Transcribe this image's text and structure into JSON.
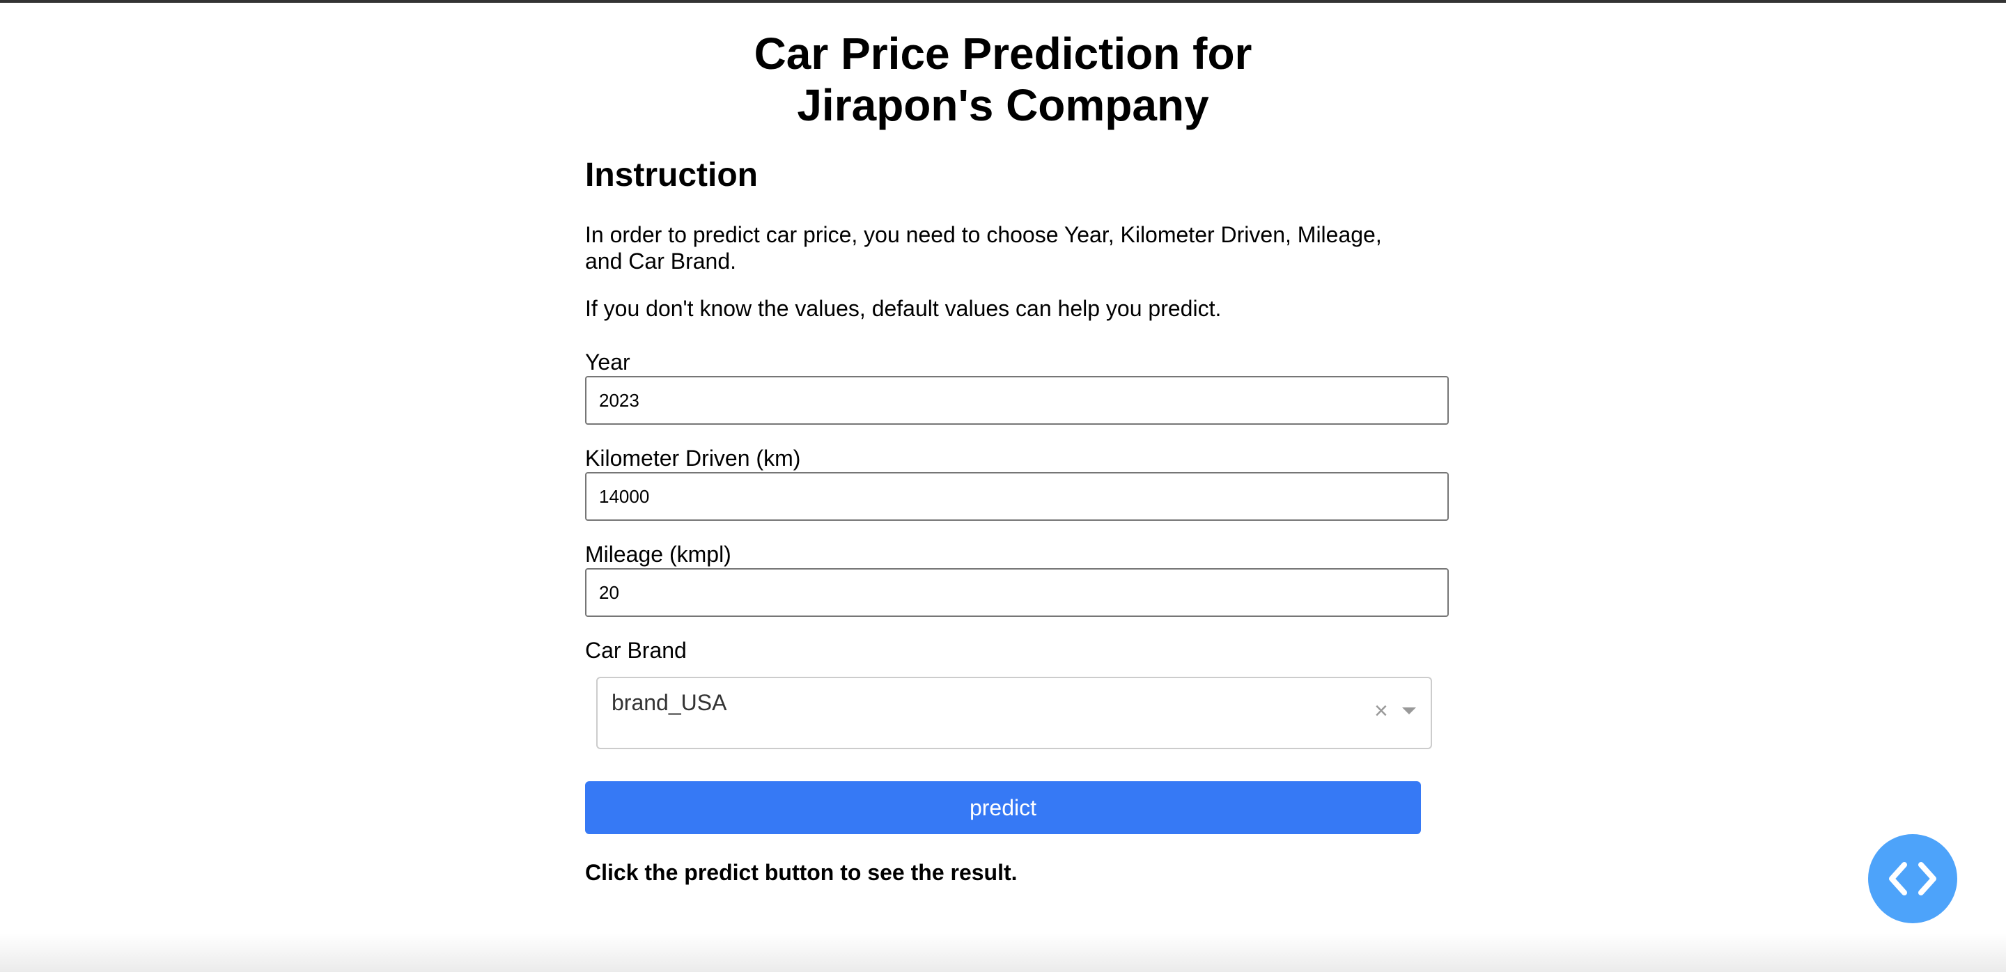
{
  "header": {
    "title": "Car Price Prediction for Jirapon's Company"
  },
  "instruction": {
    "heading": "Instruction",
    "paragraph_1": "In order to predict car price, you need to choose Year, Kilometer Driven, Mileage, and Car Brand.",
    "paragraph_2": "If you don't know the values, default values can help you predict."
  },
  "form": {
    "year": {
      "label": "Year",
      "value": "2023"
    },
    "km_driven": {
      "label": "Kilometer Driven (km)",
      "value": "14000"
    },
    "mileage": {
      "label": "Mileage (kmpl)",
      "value": "20"
    },
    "brand": {
      "label": "Car Brand",
      "selected": "brand_USA",
      "clear_glyph": "×"
    },
    "predict_label": "predict"
  },
  "result": {
    "text": "Click the predict button to see the result."
  },
  "colors": {
    "button": "#3679f5",
    "fab": "#4da3fa",
    "input_border": "#767676"
  },
  "icons": {
    "fab": "code-icon",
    "clear": "clear-icon",
    "dropdown": "chevron-down-icon"
  }
}
